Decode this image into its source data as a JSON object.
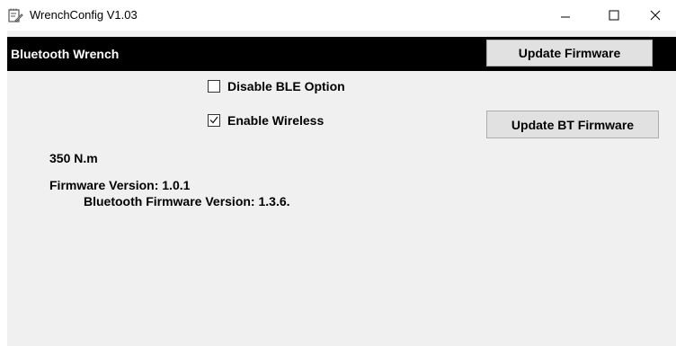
{
  "window": {
    "title": "WrenchConfig V1.03",
    "icons": {
      "app": "notepad-pencil-icon",
      "minimize": "minimize-icon",
      "maximize": "maximize-icon",
      "close": "close-icon"
    }
  },
  "header": {
    "title": "Bluetooth Wrench",
    "update_firmware_label": "Update Firmware"
  },
  "options": {
    "disable_ble": {
      "label": "Disable BLE Option",
      "checked": false
    },
    "enable_wireless": {
      "label": "Enable Wireless",
      "checked": true
    }
  },
  "update_bt_firmware_label": "Update BT Firmware",
  "info": {
    "torque": "350 N.m",
    "firmware_version": "Firmware Version: 1.0.1",
    "bluetooth_firmware_version": "Bluetooth Firmware Version: 1.3.6."
  },
  "colors": {
    "header_bg": "#000000",
    "client_bg": "#f0f0f0",
    "button_bg": "#e1e1e1"
  }
}
